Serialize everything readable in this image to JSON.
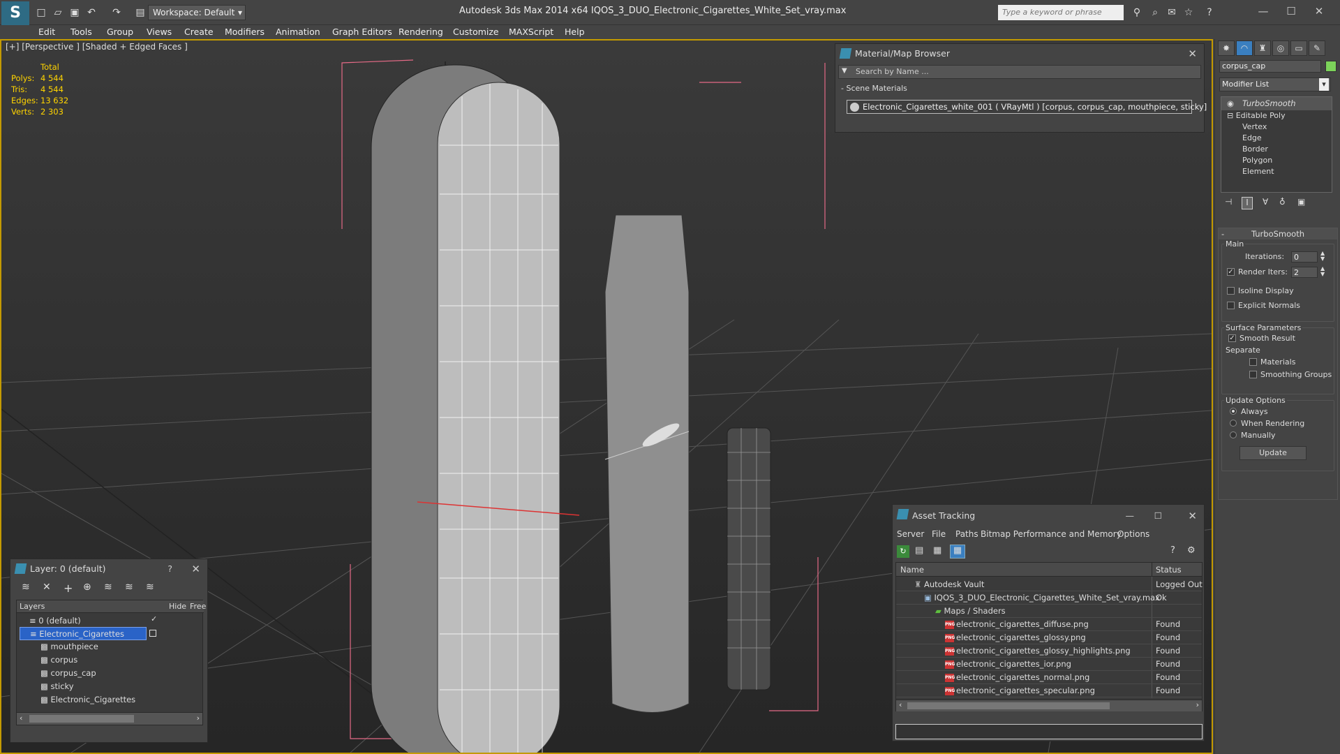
{
  "app": {
    "title": "Autodesk 3ds Max  2014 x64     IQOS_3_DUO_Electronic_Cigarettes_White_Set_vray.max",
    "workspace": "Workspace: Default",
    "search_placeholder": "Type a keyword or phrase"
  },
  "menu": [
    "Edit",
    "Tools",
    "Group",
    "Views",
    "Create",
    "Modifiers",
    "Animation",
    "Graph Editors",
    "Rendering",
    "Customize",
    "MAXScript",
    "Help"
  ],
  "viewport": {
    "label": "[+] [Perspective ] [Shaded + Edged Faces ]",
    "stats_header": "Total",
    "stats": [
      {
        "key": "Polys:",
        "value": "4 544"
      },
      {
        "key": "Tris:",
        "value": "4 544"
      },
      {
        "key": "Edges:",
        "value": "13 632"
      },
      {
        "key": "Verts:",
        "value": "2 303"
      }
    ]
  },
  "material_browser": {
    "title": "Material/Map Browser",
    "search_placeholder": "Search by Name ...",
    "section": "- Scene Materials",
    "item": "Electronic_Cigarettes_white_001  ( VRayMtl ) [corpus, corpus_cap, mouthpiece, sticky]"
  },
  "layer_panel": {
    "title": "Layer: 0 (default)",
    "help": "?",
    "col_layers": "Layers",
    "col_hide": "Hide",
    "col_freeze": "Free",
    "rows": [
      {
        "name": "0 (default)",
        "indent": 0,
        "selected": false
      },
      {
        "name": "Electronic_Cigarettes",
        "indent": 0,
        "selected": true
      },
      {
        "name": "mouthpiece",
        "indent": 1,
        "selected": false
      },
      {
        "name": "corpus",
        "indent": 1,
        "selected": false
      },
      {
        "name": "corpus_cap",
        "indent": 1,
        "selected": false
      },
      {
        "name": "sticky",
        "indent": 1,
        "selected": false
      },
      {
        "name": "Electronic_Cigarettes",
        "indent": 1,
        "selected": false
      }
    ]
  },
  "asset_tracking": {
    "title": "Asset Tracking",
    "menu": [
      "Server",
      "File",
      "Paths",
      "Bitmap Performance and Memory",
      "Options"
    ],
    "col_name": "Name",
    "col_status": "Status",
    "rows": [
      {
        "name": "Autodesk Vault",
        "status": "Logged Out",
        "indent": 0,
        "type": "vault"
      },
      {
        "name": "IQOS_3_DUO_Electronic_Cigarettes_White_Set_vray.max",
        "status": "Ok",
        "indent": 1,
        "type": "max"
      },
      {
        "name": "Maps / Shaders",
        "status": "",
        "indent": 2,
        "type": "folder"
      },
      {
        "name": "electronic_cigarettes_diffuse.png",
        "status": "Found",
        "indent": 3,
        "type": "png"
      },
      {
        "name": "electronic_cigarettes_glossy.png",
        "status": "Found",
        "indent": 3,
        "type": "png"
      },
      {
        "name": "electronic_cigarettes_glossy_highlights.png",
        "status": "Found",
        "indent": 3,
        "type": "png"
      },
      {
        "name": "electronic_cigarettes_ior.png",
        "status": "Found",
        "indent": 3,
        "type": "png"
      },
      {
        "name": "electronic_cigarettes_normal.png",
        "status": "Found",
        "indent": 3,
        "type": "png"
      },
      {
        "name": "electronic_cigarettes_specular.png",
        "status": "Found",
        "indent": 3,
        "type": "png"
      }
    ]
  },
  "command_panel": {
    "object_name": "corpus_cap",
    "object_color": "#7cd35a",
    "modifier_list": "Modifier List",
    "stack": [
      "TurboSmooth",
      "Editable Poly",
      "Vertex",
      "Edge",
      "Border",
      "Polygon",
      "Element"
    ],
    "rollout_title": "TurboSmooth",
    "main_label": "Main",
    "iterations_label": "Iterations:",
    "iterations": "0",
    "render_iters_label": "Render Iters:",
    "render_iters": "2",
    "isoline": "Isoline Display",
    "explicit_normals": "Explicit Normals",
    "surface_params": "Surface Parameters",
    "smooth_result": "Smooth Result",
    "separate": "Separate",
    "materials": "Materials",
    "smoothing_groups": "Smoothing Groups",
    "update_options": "Update Options",
    "always": "Always",
    "when_rendering": "When Rendering",
    "manually": "Manually",
    "update_button": "Update"
  },
  "colors": {
    "accent": "#c49a00",
    "selection": "#2a63c7",
    "stats": "#ffd400"
  }
}
